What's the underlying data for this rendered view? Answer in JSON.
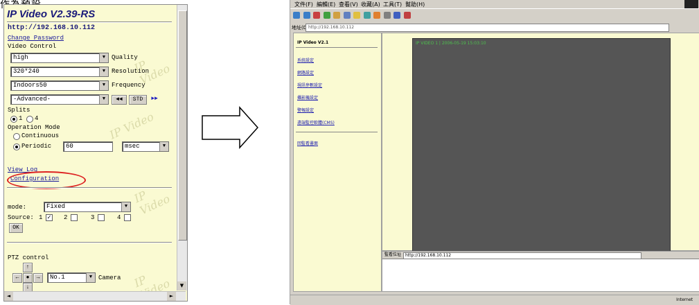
{
  "caption": "作為預設",
  "left_panel": {
    "title": "IP Video V2.39-RS",
    "url": "http://192.168.10.112",
    "change_password": "Change Password",
    "video_control_label": "Video Control",
    "quality_value": "high",
    "quality_label": "Quality",
    "resolution_value": "320*240",
    "resolution_label": "Resolution",
    "frequency_value": "Indoors50",
    "frequency_label": "Frequency",
    "advanced_value": "-Advanced-",
    "btn_prev": "◄◄",
    "btn_std": "STD",
    "btn_next": "►►",
    "splits_label": "Splits",
    "split_1": "1",
    "split_4": "4",
    "operation_mode_label": "Operation Mode",
    "continuous_label": "Continuous",
    "periodic_label": "Periodic",
    "periodic_value": "60",
    "periodic_unit": "msec",
    "view_log": "View Log",
    "configuration": "Configuration",
    "mode_label": "mode:",
    "mode_value": "Fixed",
    "source_label": "Source:",
    "source_1": "1",
    "source_2": "2",
    "source_3": "3",
    "source_4": "4",
    "ok_label": "OK",
    "ptz_label": "PTZ control",
    "camera_value": "No.1",
    "camera_label": "Camera",
    "watermark": "IP Video"
  },
  "browser": {
    "menu": [
      "文件(F)",
      "編輯(E)",
      "查看(V)",
      "收藏(A)",
      "工具(T)",
      "幫助(H)"
    ],
    "address_label": "地址(D)",
    "address_value": "http://192.168.10.112",
    "nav_title": "IP Video V2.1",
    "nav_links": [
      "系統設定",
      "網路設定",
      "視訊參數設定",
      "攝影機設定",
      "警報設定",
      "遠端監控軟體(CMS)"
    ],
    "nav_link_extra": "回監看畫面",
    "video_label": "IP VIDEO 1 | 2006-05-19 15:03:10",
    "status_url_label": "監看位址",
    "status_url_value": "http://192.168.10.112",
    "status_right": "Internet"
  }
}
